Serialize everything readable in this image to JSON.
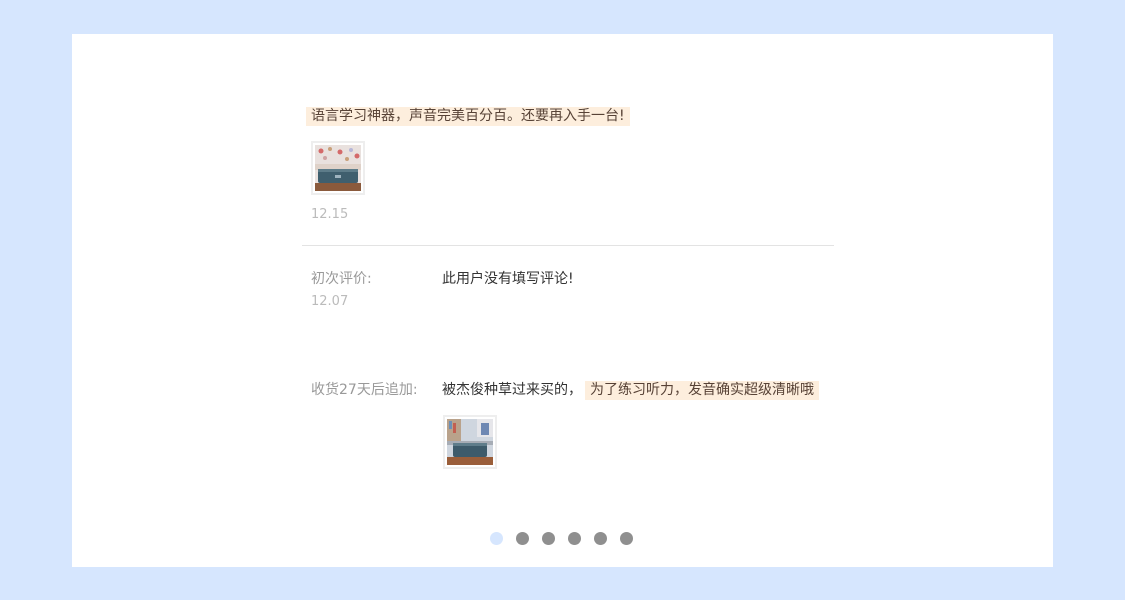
{
  "review": {
    "first_highlight": "语言学习神器，声音完美百分百。还要再入手一台!",
    "first_date": "12.15",
    "initial_label": "初次评价:",
    "initial_date": "12.07",
    "initial_text": "此用户没有填写评论!",
    "followup_label": "收货27天后追加:",
    "followup_text": "被杰俊种草过来买的，",
    "followup_highlight": "为了练习听力，发音确实超级清晰哦"
  },
  "carousel": {
    "dot_count": 6,
    "active_index": 0
  }
}
